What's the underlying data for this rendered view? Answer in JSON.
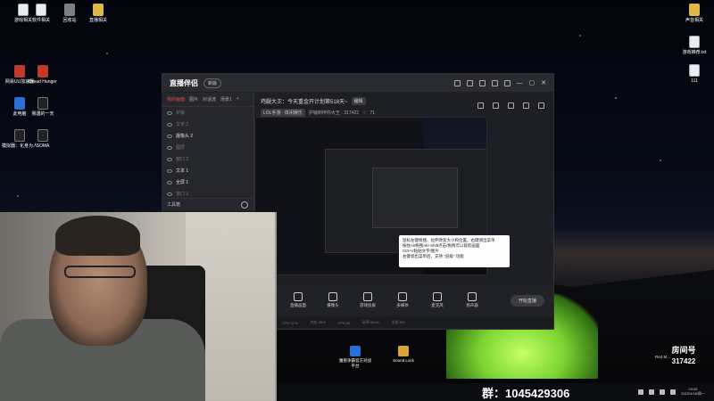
{
  "desktop": {
    "left_icons": [
      {
        "label": "游戏相关"
      },
      {
        "label": "软件相关"
      },
      {
        "label": "回收站"
      },
      {
        "label": "直播相关"
      },
      {
        "label": "网易UU加速器"
      },
      {
        "label": "Dread Hunger"
      },
      {
        "label": "此电脑"
      },
      {
        "label": "我遇的一天"
      },
      {
        "label": "模拟器：化身为人"
      },
      {
        "label": "SOMA"
      }
    ],
    "right_icons": [
      {
        "label": "声音相关"
      },
      {
        "label": "游戏推荐.txt"
      },
      {
        "label": "111"
      }
    ],
    "bottom_icons": [
      {
        "label": "魔兽争霸官方对战平台"
      },
      {
        "label": "Sound Lock"
      }
    ]
  },
  "obs": {
    "logo": "直播伴侣",
    "logo_suffix": "20",
    "version_pill": "新版",
    "room_title": "鸡腿大王：今天重金开计划第518天~",
    "edit_tag": "编辑",
    "lol_tag": "LOL手游 · 体闲娱乐",
    "watch_text": "护输到伴你大王 · 317422",
    "like_count": "71",
    "scene_tabs": [
      "我的画面",
      "图片",
      "对话流",
      "场景1"
    ],
    "sources": [
      {
        "label": "护输",
        "on": false
      },
      {
        "label": "文字 2",
        "on": false
      },
      {
        "label": "摄像头 2",
        "on": true
      },
      {
        "label": "图层",
        "on": false
      },
      {
        "label": "窗口 2",
        "on": false
      },
      {
        "label": "文本 1",
        "on": true
      },
      {
        "label": "全屏 1",
        "on": true
      },
      {
        "label": "窗口 1",
        "on": false
      }
    ],
    "scene_footer": "工具箱",
    "tooltip": "鼠标左键拖拽，拉伸改变大小和位置。右键调出菜单\n按住Alt拖拽Alt+Shift点击/拖拽可以裁剪画面\nCtrl+V粘贴文字/图片\n右键调出菜单后，支持 \"层级\" 功能",
    "toolbar": [
      {
        "label": "直播画面",
        "icon": "screen-icon"
      },
      {
        "label": "摄像头",
        "icon": "camera-icon"
      },
      {
        "label": "游戏投屏",
        "icon": "cast-icon"
      },
      {
        "label": "多媒体",
        "icon": "media-icon"
      },
      {
        "label": "麦克风",
        "icon": "mic-icon"
      },
      {
        "label": "扬声器",
        "icon": "speaker-icon"
      }
    ],
    "start_button": "开始直播",
    "status_items": [
      "CPU 21%",
      "内存 45%",
      "FPS 60",
      "码率 0kb/s",
      "丢帧 0%"
    ]
  },
  "taskbar": {
    "qq_group": "群：1045429306",
    "time": "23:06",
    "date": "2022/4/18/周一"
  },
  "room": {
    "title": "房间号",
    "number": "317422",
    "redm": "Red M..."
  }
}
